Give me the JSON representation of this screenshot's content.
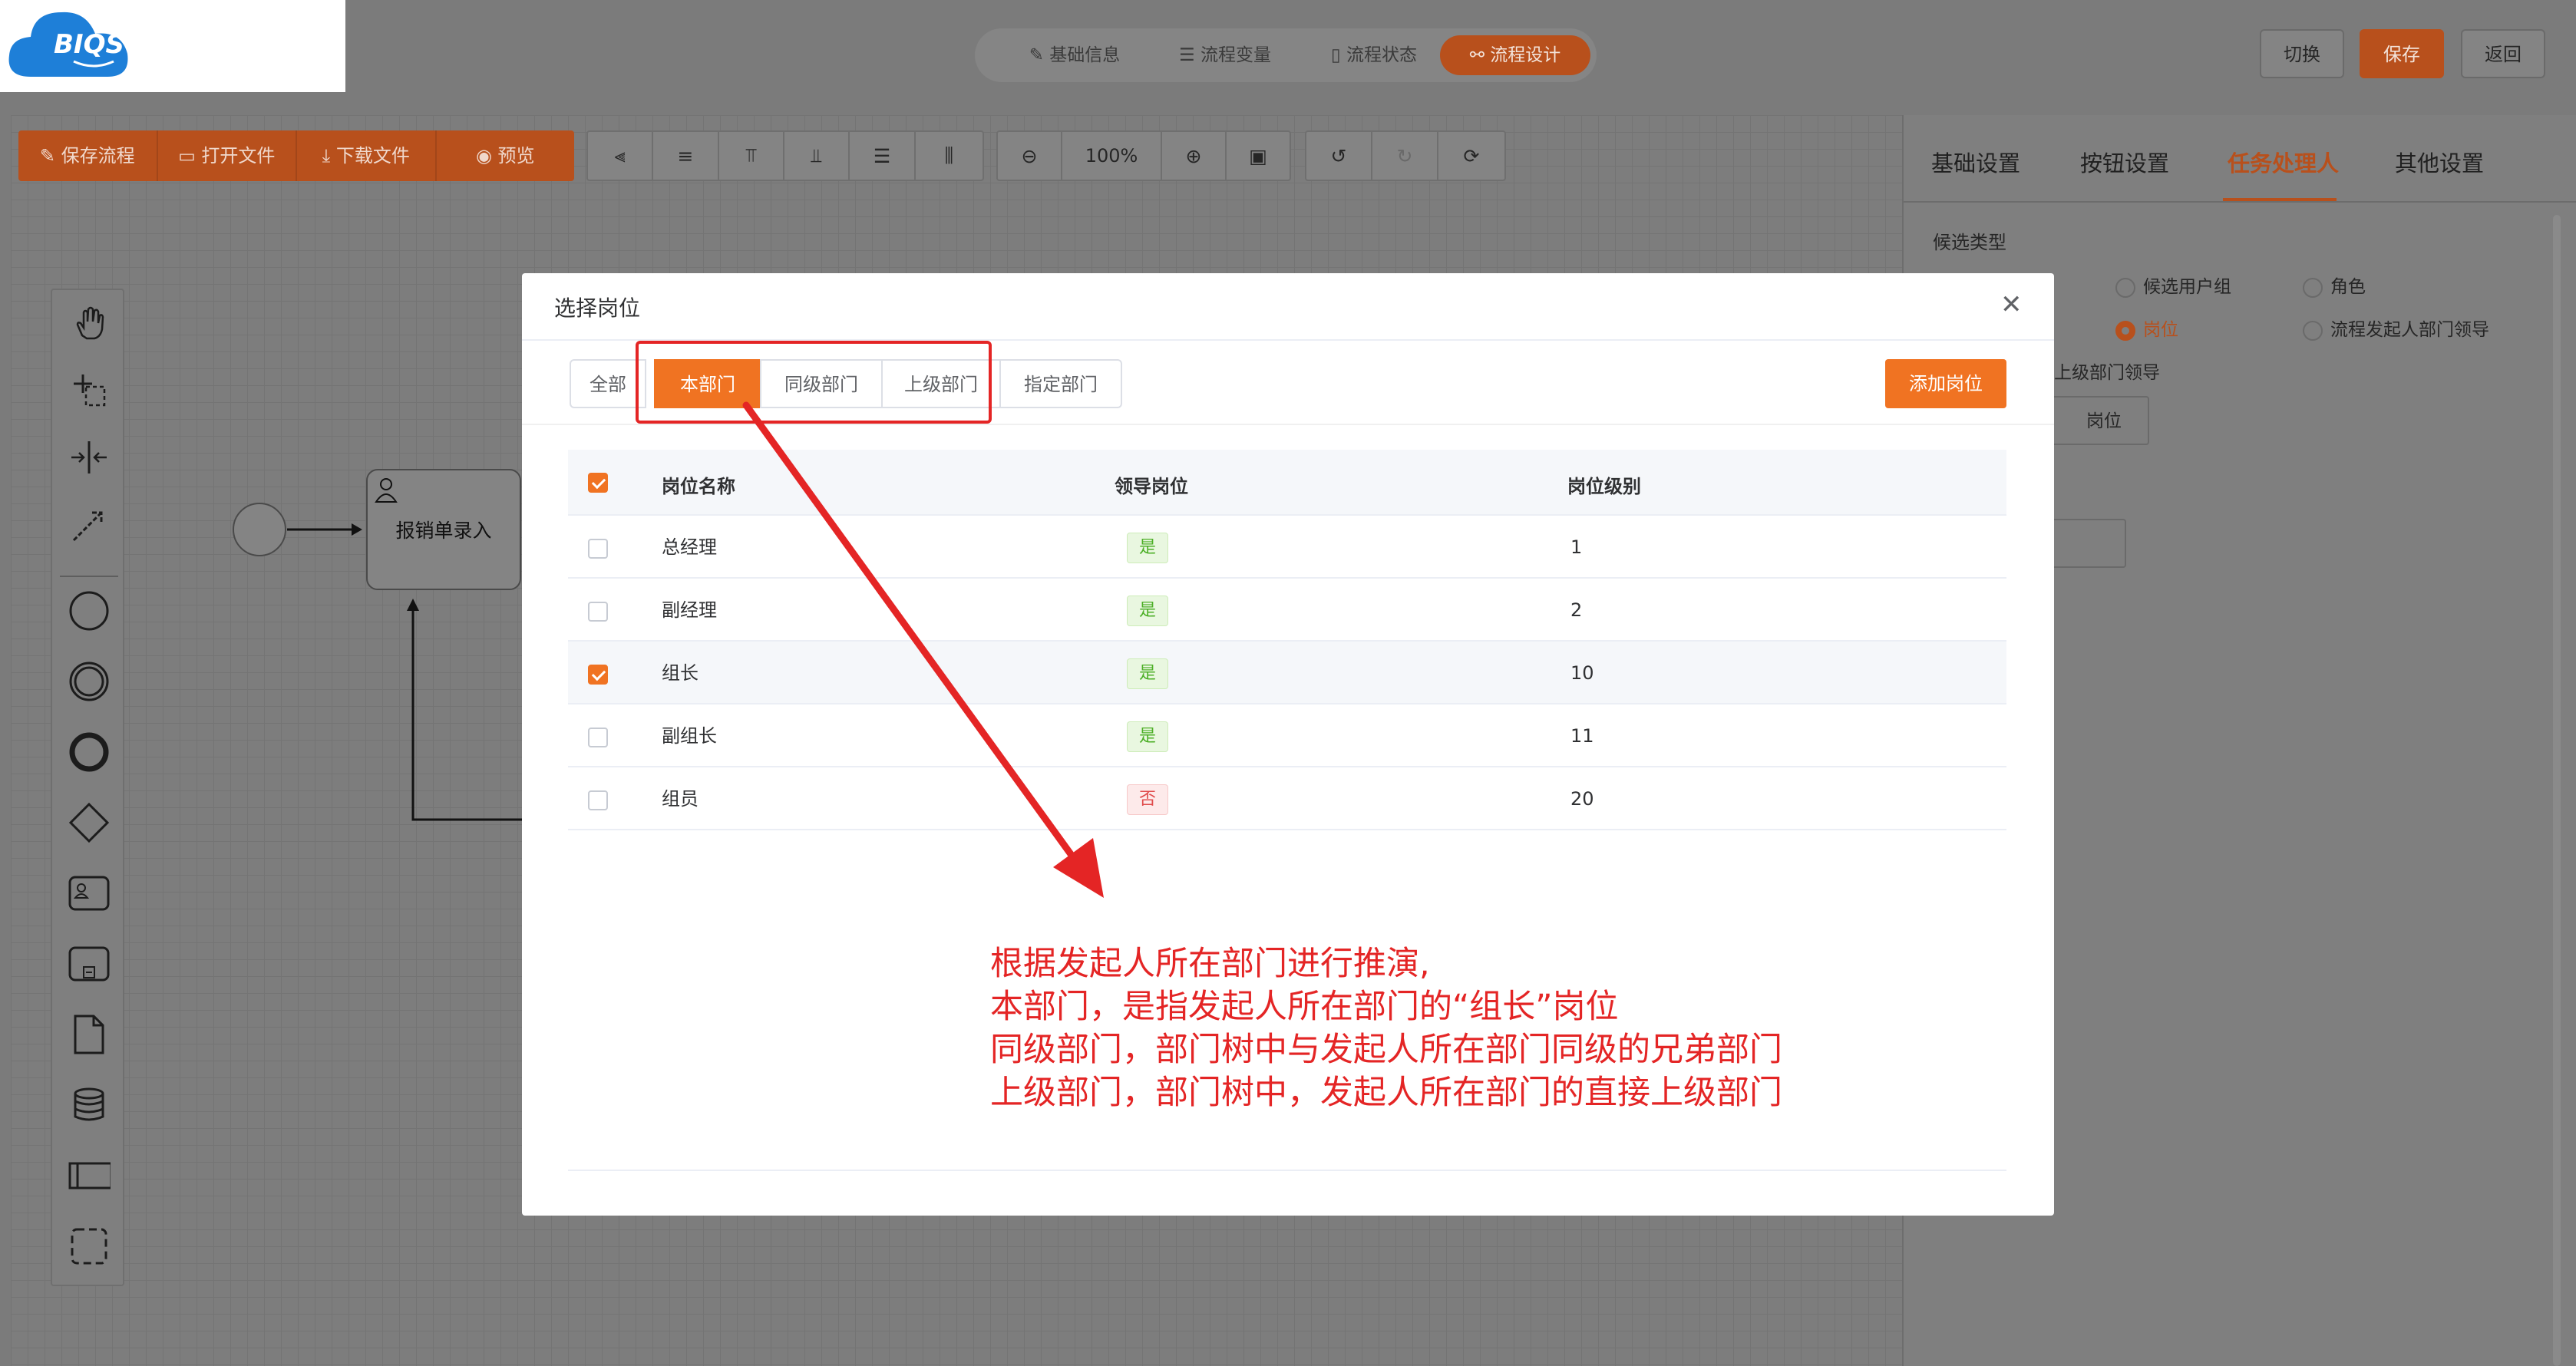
{
  "app": {
    "logo_text": "BIQS"
  },
  "header": {
    "tabs": [
      {
        "label": "基础信息"
      },
      {
        "label": "流程变量"
      },
      {
        "label": "流程状态"
      },
      {
        "label": "流程设计",
        "active": true
      }
    ],
    "switch_label": "切换",
    "save_label": "保存",
    "back_label": "返回"
  },
  "toolbar": {
    "save_flow": "保存流程",
    "open_file": "打开文件",
    "download_file": "下载文件",
    "preview": "预览",
    "zoom_level": "100%"
  },
  "diagram": {
    "task_label": "报销单录入"
  },
  "right_panel": {
    "tabs": [
      {
        "label": "基础设置"
      },
      {
        "label": "按钮设置"
      },
      {
        "label": "任务处理人",
        "active": true
      },
      {
        "label": "其他设置"
      }
    ],
    "candidate_type_label": "候选类型",
    "options": [
      "候选用户组",
      "角色",
      "岗位",
      "流程发起人部门领导"
    ],
    "selected_option": "岗位",
    "sub_label": "上级部门领导",
    "post_button": "岗位"
  },
  "modal": {
    "title": "选择岗位",
    "segments": [
      {
        "label": "全部"
      },
      {
        "label": "本部门",
        "active": true
      },
      {
        "label": "同级部门"
      },
      {
        "label": "上级部门"
      },
      {
        "label": "指定部门"
      }
    ],
    "add_button": "添加岗位",
    "columns": [
      "岗位名称",
      "领导岗位",
      "岗位级别"
    ],
    "rows": [
      {
        "name": "总经理",
        "leader": "是",
        "level": "1",
        "checked": false
      },
      {
        "name": "副经理",
        "leader": "是",
        "level": "2",
        "checked": false
      },
      {
        "name": "组长",
        "leader": "是",
        "level": "10",
        "checked": true
      },
      {
        "name": "副组长",
        "leader": "是",
        "level": "11",
        "checked": false
      },
      {
        "name": "组员",
        "leader": "否",
        "level": "20",
        "checked": false
      }
    ]
  },
  "annotation": {
    "lines": [
      "根据发起人所在部门进行推演,",
      "本部门，是指发起人所在部门的“组长”岗位",
      "同级部门，部门树中与发起人所在部门同级的兄弟部门",
      "上级部门，部门树中，发起人所在部门的直接上级部门"
    ]
  },
  "colors": {
    "accent": "#f07322",
    "annotation": "#e42525",
    "overlay": "#7b7b7b"
  }
}
